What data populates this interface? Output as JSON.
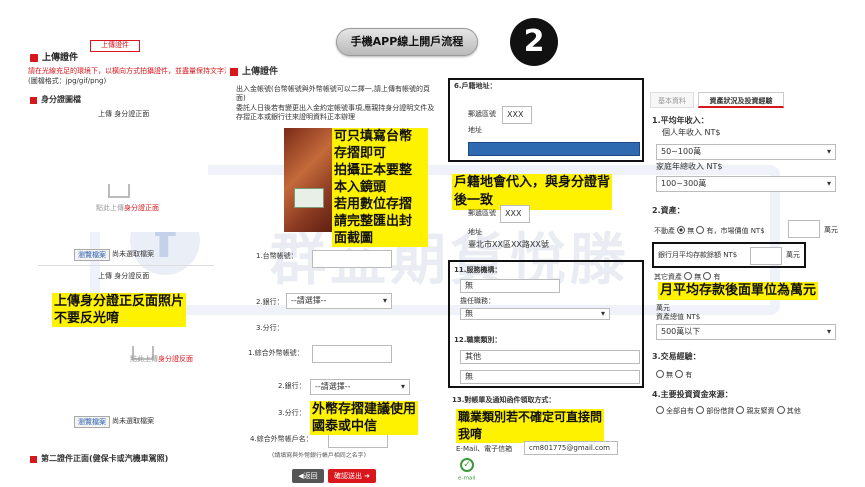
{
  "header": {
    "title": "手機APP線上開戶流程",
    "step": "2"
  },
  "panel1": {
    "tab": "上傳證件",
    "heading": "上傳證件",
    "notice": "請在光線充足的環境下，以橫向方式拍攝證件，並盡量保持文字清晰",
    "format": "(圖檔格式：jpg/gif/png)",
    "id_section": "身分證圖檔",
    "front_label": "上傳 身分證正面",
    "front_hint_a": "點此上傳",
    "front_hint_b": "身分證正面",
    "browse": "瀏覽檔案",
    "no_file": "尚未選取檔案",
    "back_label": "上傳 身分證反面",
    "back_hint_a": "點此上傳",
    "back_hint_b": "身分證反面",
    "browse2": "瀏覽檔案",
    "no_file2": "尚未選取檔案",
    "second_doc": "第二證件正面(健保卡或汽機車駕照)",
    "annotation": "上傳身分證正反面照片\n不要反光唷"
  },
  "panel2": {
    "heading": "上傳證件",
    "desc1": "出入金帳號(台幣帳號與外幣帳號可以二擇一,請上傳有帳號的頁面)",
    "desc2": "委託人日後若有變更出入金約定帳號事項,應親持身分證明文件及存摺正本或銀行往來證明資料正本辦理",
    "annotation_passbook": "可只填寫台幣\n存摺即可\n拍攝正本要整\n本入鏡頭\n若用數位存摺\n請完整匯出封\n面截圖",
    "f1_label": "1.台幣帳號：",
    "f2_label": "2.銀行：",
    "f2_value": "--請選擇--",
    "f3_label": "3.分行：",
    "f4_label": "1.綜合外幣帳號：",
    "f5_label": "2.銀行：",
    "f5_value": "--請選擇--",
    "f6_label": "3.分行：",
    "f7_label": "4.綜合外幣帳戶名：",
    "f7_note": "(請填寫與外幣銀行帳戶相同之名字)",
    "annotation_fx": "外幣存摺建議使用\n國泰或中信",
    "back_btn": "◀返回",
    "submit_btn": "確認送出 ➜"
  },
  "panel3": {
    "hk_title": "6.戶籍地址：",
    "zip_label": "郵遞區號",
    "zip_value": "XXX",
    "addr_label": "地址",
    "annotation_addr": "戶籍地會代入，與身分證背\n後一致",
    "zip2_label": "郵遞區號",
    "zip2_value": "XXX",
    "addr2_label": "地址",
    "addr2_value": "臺北市XX區XX路XX號",
    "job_title": "11.服務機構：",
    "job_value": "無",
    "position_label": "擔任職務：",
    "position_value": "無",
    "jobcat_title": "12.職業類別：",
    "jobcat_value": "其他",
    "jobcat_value2": "無",
    "mail_title": "13.對帳單及通知函件領取方式：",
    "annotation_job": "職業類別若不確定可直接問\n我唷",
    "email_label": "E-Mail、電子信箱",
    "email_value": "cm801775@gmail.com",
    "check_label": "e-mail"
  },
  "panel4": {
    "tab_basic": "基本資料",
    "tab_finance": "資產狀況及投資經驗",
    "q1": "1.平均年收入：",
    "personal_income_label": "個人年收入 NT$",
    "personal_income_value": "50~100萬",
    "family_income_label": "家庭年總收入 NT$",
    "family_income_value": "100~300萬",
    "q2": "2.資產：",
    "realestate_label": "不動產",
    "realestate_no": "無",
    "realestate_yes": "有",
    "market_label": "，市場價值 NT$",
    "unit1": "萬元",
    "bank_label": "銀行月平均存款餘額 NT$",
    "bank_unit": "萬元",
    "other_label": "其它資產",
    "other_no": "無",
    "other_yes": "有",
    "annotation_unit": "月平均存款後面單位為萬元",
    "money_unit": "萬元",
    "asset_value_label": "資產總值 NT$",
    "asset_value_value": "500萬以下",
    "q3": "3.交易經驗：",
    "exp_no": "無",
    "exp_yes": "有",
    "q4": "4.主要投資資金來源：",
    "src1": "全部自有",
    "src2": "部份借貸",
    "src3": "親友緊資",
    "src4": "其他"
  },
  "watermark": "群益期貨悅滕"
}
